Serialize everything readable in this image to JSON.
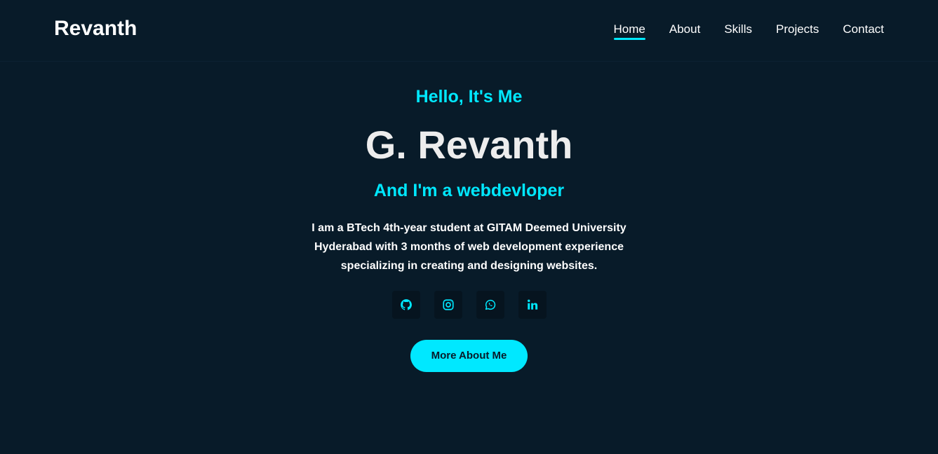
{
  "header": {
    "logo": "Revanth",
    "nav": [
      {
        "label": "Home",
        "active": true
      },
      {
        "label": "About",
        "active": false
      },
      {
        "label": "Skills",
        "active": false
      },
      {
        "label": "Projects",
        "active": false
      },
      {
        "label": "Contact",
        "active": false
      }
    ]
  },
  "hero": {
    "greeting": "Hello, It's Me",
    "name": "G. Revanth",
    "role": "And I'm a webdevloper",
    "description": "I am a BTech 4th-year student at GITAM Deemed University Hyderabad with 3 months of web development experience specializing in creating and designing websites.",
    "social_icons": [
      "github-icon",
      "instagram-icon",
      "whatsapp-icon",
      "linkedin-icon"
    ],
    "cta_label": "More About Me"
  },
  "colors": {
    "background": "#081b29",
    "accent": "#00e8ff",
    "text": "#ededed"
  }
}
